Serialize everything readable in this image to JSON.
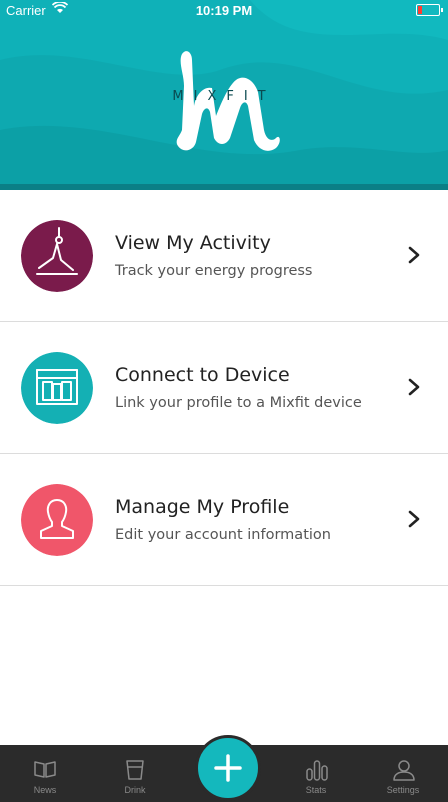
{
  "status_bar": {
    "carrier": "Carrier",
    "time": "10:19 PM"
  },
  "header": {
    "logo_text": "MIXFIT"
  },
  "menu": {
    "items": [
      {
        "title": "View My Activity",
        "subtitle": "Track your energy progress",
        "icon": "yoga-icon",
        "color": "#7a1b4b"
      },
      {
        "title": "Connect to Device",
        "subtitle": "Link your profile to a Mixfit device",
        "icon": "device-icon",
        "color": "#14b0b4"
      },
      {
        "title": "Manage My Profile",
        "subtitle": "Edit your account information",
        "icon": "profile-icon",
        "color": "#f0566a"
      }
    ]
  },
  "tabbar": {
    "tabs": [
      {
        "label": "News",
        "icon": "book-icon"
      },
      {
        "label": "Drink",
        "icon": "cup-icon"
      },
      {
        "label": "Stats",
        "icon": "bar-chart-icon"
      },
      {
        "label": "Settings",
        "icon": "person-icon"
      }
    ],
    "add_icon": "plus-icon",
    "accent": "#14b8bd"
  }
}
